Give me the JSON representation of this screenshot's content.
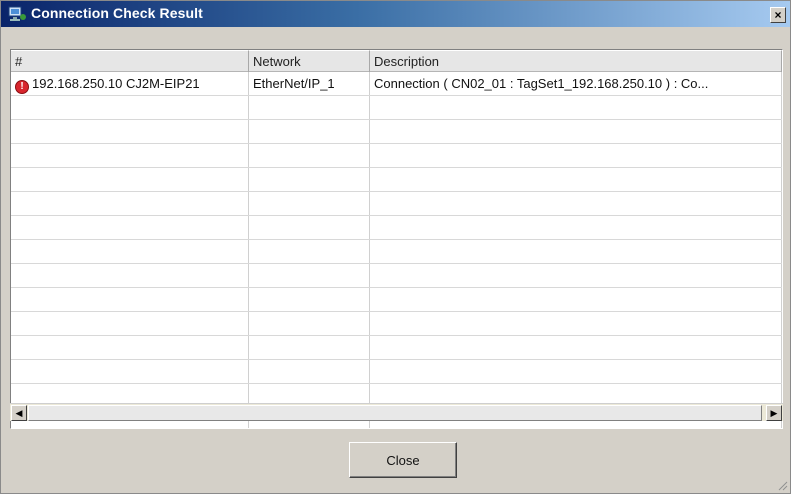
{
  "window": {
    "title": "Connection Check Result",
    "close_glyph": "×",
    "title_icon": "network-computer-icon"
  },
  "table": {
    "columns": [
      "#",
      "Network",
      "Description"
    ],
    "rows": [
      {
        "status_icon": "error-icon",
        "status_glyph": "!",
        "number": "192.168.250.10 CJ2M-EIP21",
        "network": "EtherNet/IP_1",
        "description": "Connection ( CN02_01 : TagSet1_192.168.250.10 ) : Co..."
      }
    ]
  },
  "scrollbar": {
    "left_arrow": "◀",
    "right_arrow": "▶"
  },
  "footer": {
    "close_label": "Close"
  },
  "colors": {
    "titlebar_start": "#0a246a",
    "titlebar_end": "#a6caf0",
    "error": "#d8262e"
  }
}
